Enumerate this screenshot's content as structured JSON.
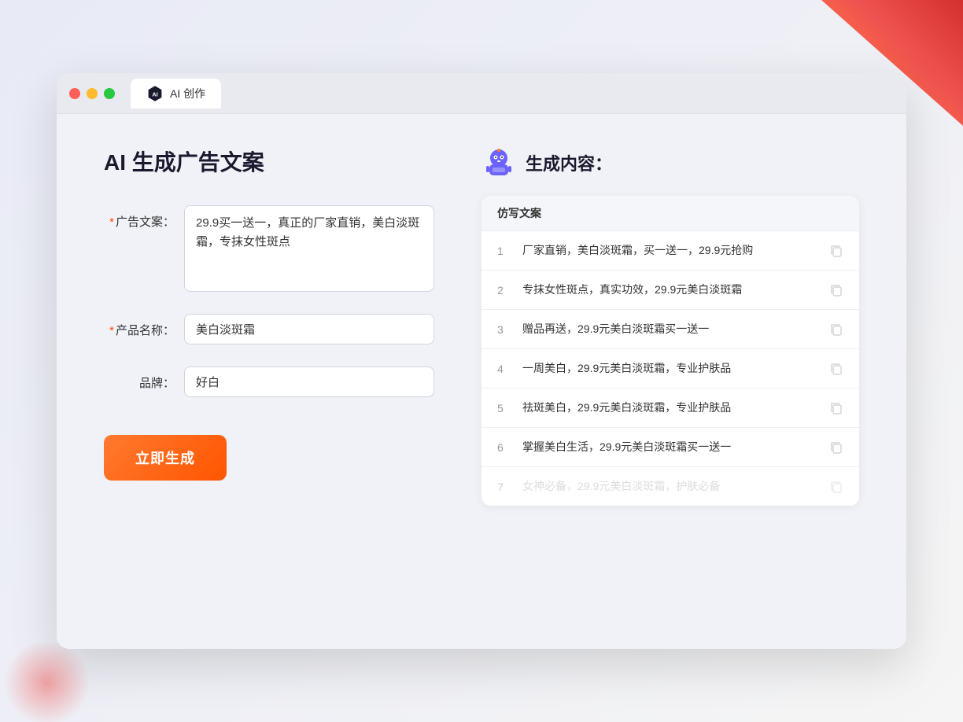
{
  "window": {
    "tab_label": "AI 创作"
  },
  "page": {
    "title": "AI 生成广告文案",
    "result_header": "生成内容："
  },
  "form": {
    "ad_copy_label": "广告文案：",
    "ad_copy_required": true,
    "ad_copy_value": "29.9买一送一，真正的厂家直销，美白淡斑霜，专抹女性斑点",
    "product_name_label": "产品名称：",
    "product_name_required": true,
    "product_name_value": "美白淡斑霜",
    "brand_label": "品牌：",
    "brand_required": false,
    "brand_value": "好白",
    "generate_btn_label": "立即生成"
  },
  "results": {
    "column_header": "仿写文案",
    "items": [
      {
        "num": "1",
        "text": "厂家直销，美白淡斑霜，买一送一，29.9元抢购"
      },
      {
        "num": "2",
        "text": "专抹女性斑点，真实功效，29.9元美白淡斑霜"
      },
      {
        "num": "3",
        "text": "赠品再送，29.9元美白淡斑霜买一送一"
      },
      {
        "num": "4",
        "text": "一周美白，29.9元美白淡斑霜，专业护肤品"
      },
      {
        "num": "5",
        "text": "祛斑美白，29.9元美白淡斑霜，专业护肤品"
      },
      {
        "num": "6",
        "text": "掌握美白生活，29.9元美白淡斑霜买一送一"
      },
      {
        "num": "7",
        "text": "女神必备，29.9元美白淡斑霜，护肤必备"
      }
    ]
  }
}
